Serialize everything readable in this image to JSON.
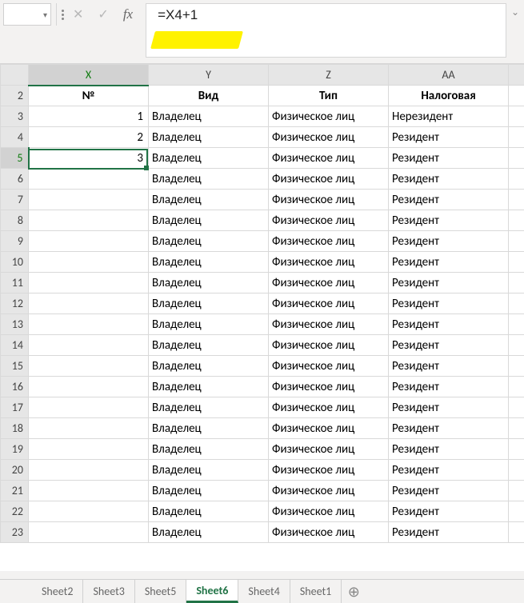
{
  "formula_bar": {
    "name_box": "",
    "formula": "=X4+1"
  },
  "columns": [
    "X",
    "Y",
    "Z",
    "AA"
  ],
  "selected_column": "X",
  "selected_row": 5,
  "header_row_index": 2,
  "headers": {
    "X": "№",
    "Y": "Вид",
    "Z": "Тип",
    "AA": "Налоговая"
  },
  "rows": [
    {
      "n": 2,
      "X": "№",
      "Y": "Вид",
      "Z": "Тип",
      "AA": "Налоговая"
    },
    {
      "n": 3,
      "X": "1",
      "Y": "Владелец",
      "Z": "Физическое лиц",
      "AA": "Нерезидент"
    },
    {
      "n": 4,
      "X": "2",
      "Y": "Владелец",
      "Z": "Физическое лиц",
      "AA": "Резидент"
    },
    {
      "n": 5,
      "X": "3",
      "Y": "Владелец",
      "Z": "Физическое лиц",
      "AA": "Резидент"
    },
    {
      "n": 6,
      "X": "",
      "Y": "Владелец",
      "Z": "Физическое лиц",
      "AA": "Резидент"
    },
    {
      "n": 7,
      "X": "",
      "Y": "Владелец",
      "Z": "Физическое лиц",
      "AA": "Резидент"
    },
    {
      "n": 8,
      "X": "",
      "Y": "Владелец",
      "Z": "Физическое лиц",
      "AA": "Резидент"
    },
    {
      "n": 9,
      "X": "",
      "Y": "Владелец",
      "Z": "Физическое лиц",
      "AA": "Резидент"
    },
    {
      "n": 10,
      "X": "",
      "Y": "Владелец",
      "Z": "Физическое лиц",
      "AA": "Резидент"
    },
    {
      "n": 11,
      "X": "",
      "Y": "Владелец",
      "Z": "Физическое лиц",
      "AA": "Резидент"
    },
    {
      "n": 12,
      "X": "",
      "Y": "Владелец",
      "Z": "Физическое лиц",
      "AA": "Резидент"
    },
    {
      "n": 13,
      "X": "",
      "Y": "Владелец",
      "Z": "Физическое лиц",
      "AA": "Резидент"
    },
    {
      "n": 14,
      "X": "",
      "Y": "Владелец",
      "Z": "Физическое лиц",
      "AA": "Резидент"
    },
    {
      "n": 15,
      "X": "",
      "Y": "Владелец",
      "Z": "Физическое лиц",
      "AA": "Резидент"
    },
    {
      "n": 16,
      "X": "",
      "Y": "Владелец",
      "Z": "Физическое лиц",
      "AA": "Резидент"
    },
    {
      "n": 17,
      "X": "",
      "Y": "Владелец",
      "Z": "Физическое лиц",
      "AA": "Резидент"
    },
    {
      "n": 18,
      "X": "",
      "Y": "Владелец",
      "Z": "Физическое лиц",
      "AA": "Резидент"
    },
    {
      "n": 19,
      "X": "",
      "Y": "Владелец",
      "Z": "Физическое лиц",
      "AA": "Резидент"
    },
    {
      "n": 20,
      "X": "",
      "Y": "Владелец",
      "Z": "Физическое лиц",
      "AA": "Резидент"
    },
    {
      "n": 21,
      "X": "",
      "Y": "Владелец",
      "Z": "Физическое лиц",
      "AA": "Резидент"
    },
    {
      "n": 22,
      "X": "",
      "Y": "Владелец",
      "Z": "Физическое лиц",
      "AA": "Резидент"
    },
    {
      "n": 23,
      "X": "",
      "Y": "Владелец",
      "Z": "Физическое лиц",
      "AA": "Резидент"
    }
  ],
  "sheet_tabs": [
    "Sheet2",
    "Sheet3",
    "Sheet5",
    "Sheet6",
    "Sheet4",
    "Sheet1"
  ],
  "active_sheet": "Sheet6"
}
